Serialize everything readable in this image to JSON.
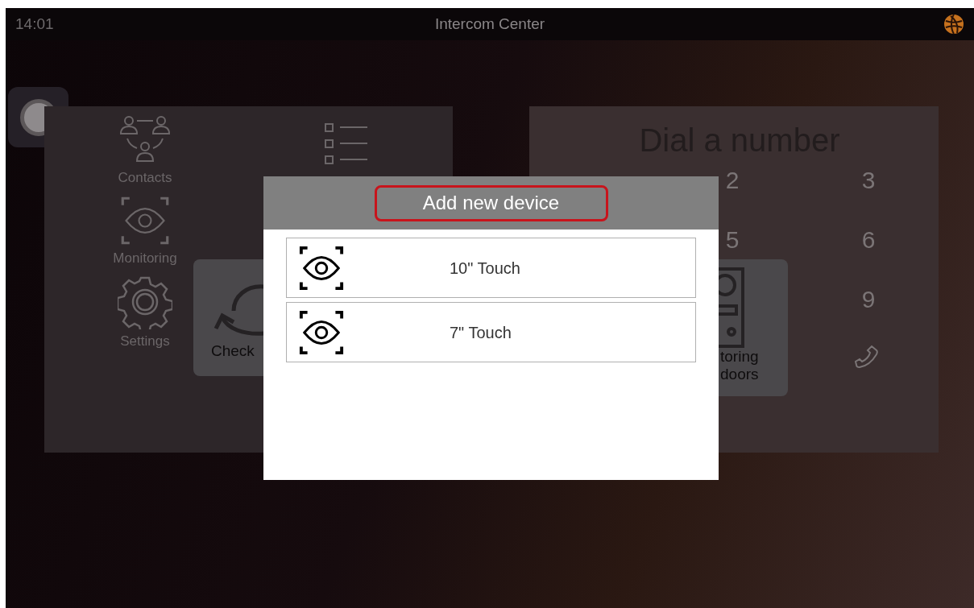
{
  "status_bar": {
    "time": "14:01",
    "title": "Intercom Center"
  },
  "menu": [
    {
      "kind": "contacts",
      "label": "Contacts"
    },
    {
      "kind": "monitoring",
      "label": "Monitoring"
    },
    {
      "kind": "settings",
      "label": "Settings"
    }
  ],
  "check_card": {
    "label": "Check"
  },
  "dialpad": {
    "title": "Dial a number",
    "rows": [
      [
        "",
        "2",
        "3"
      ],
      [
        "",
        "5",
        "6"
      ],
      [
        "",
        "",
        "9"
      ]
    ]
  },
  "monitoring_card": {
    "lines": [
      "toring",
      "doors"
    ]
  },
  "dialog": {
    "title": "Add new device",
    "devices": [
      {
        "label": "10\" Touch"
      },
      {
        "label": "7\" Touch"
      }
    ]
  }
}
